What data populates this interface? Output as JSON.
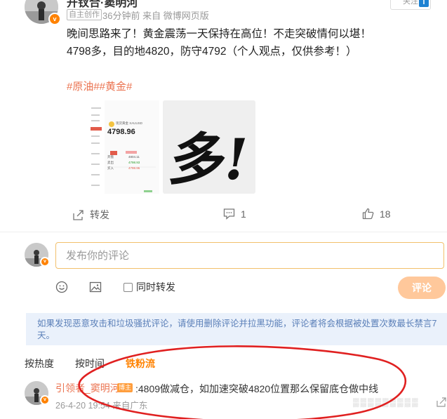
{
  "post": {
    "author": "开钗合·窦明河",
    "tag": "自主创作",
    "time": "36分钟前",
    "source": "来自 微博网页版",
    "follow_label": "关注",
    "lines": [
      "晚间思路来了！黄金震荡一天保持在高位！不走突破情何以堪！",
      "4798多，目的地4820，防守4792（个人观点，仅供参考！）"
    ],
    "hashtags": "#原油##黄金#",
    "image_text": "多!",
    "thumb": {
      "name": "现货黄金 XAUUSD",
      "price": "4798.96",
      "rows": [
        {
          "label": "开盘",
          "value": "4804.11"
        },
        {
          "label": "卖出",
          "value": "4798.93"
        },
        {
          "label": "买入",
          "value": "4798.96"
        }
      ]
    },
    "actions": {
      "repost_label": "转发",
      "comment_count": "1",
      "like_count": "18"
    }
  },
  "composer": {
    "placeholder": "发布你的评论",
    "repost_label": "同时转发",
    "submit_label": "评论"
  },
  "notice": "如果发现恶意攻击和垃圾骚扰评论，请使用删除评论并拉黑功能，评论者将会根据被处置次数最长禁言7天。",
  "sort_tabs": [
    {
      "label": "按热度"
    },
    {
      "label": "按时间"
    },
    {
      "label": "铁粉流"
    }
  ],
  "comment": {
    "user": "引领者_窦明河",
    "badge": "博主",
    "text": ":4809做减仓，如加速突破4820位置那么保留底仓做中线",
    "time": "26-4-20 19:54",
    "source": "来自广东"
  },
  "colors": {
    "accent": "#ff8200",
    "link": "#eb7350",
    "notice_bg": "#eaf1fb",
    "annotation": "#e02020"
  }
}
